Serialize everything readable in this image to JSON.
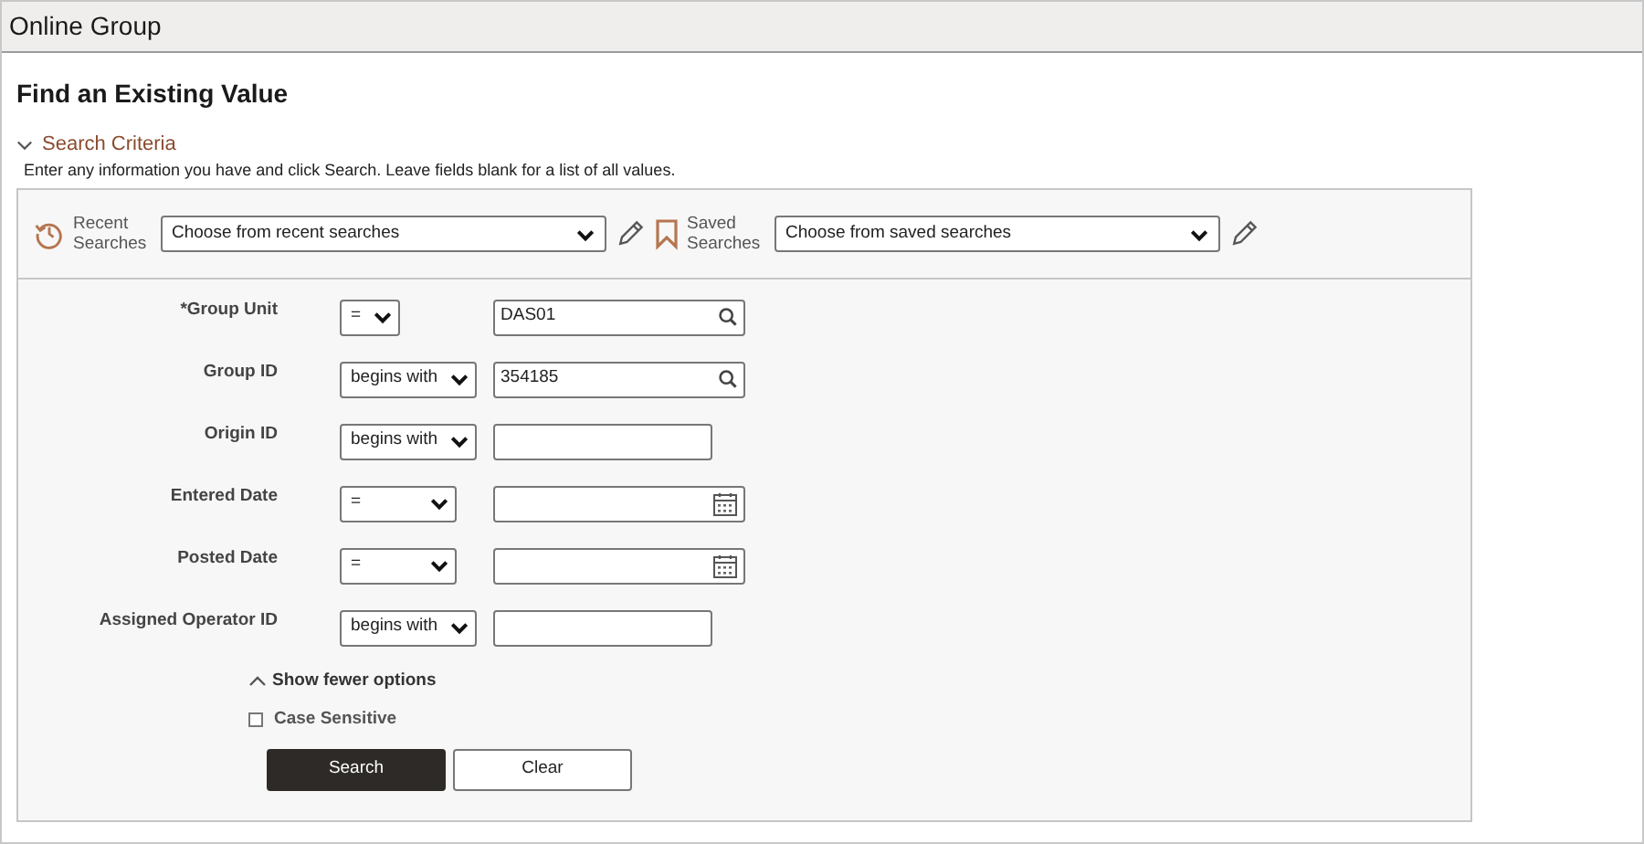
{
  "header": {
    "title": "Online Group"
  },
  "page_title": "Find an Existing Value",
  "section": {
    "title": "Search Criteria",
    "expanded": true
  },
  "instructions": "Enter any information you have and click Search. Leave fields blank for a list of all values.",
  "recent": {
    "label": "Recent Searches",
    "placeholder": "Choose from recent searches"
  },
  "saved": {
    "label": "Saved Searches",
    "placeholder": "Choose from saved searches"
  },
  "criteria": [
    {
      "label": "*Group Unit",
      "operator": "=",
      "kind": "lookup",
      "value": "DAS01"
    },
    {
      "label": "Group ID",
      "operator": "begins with",
      "kind": "lookup",
      "value": "354185"
    },
    {
      "label": "Origin ID",
      "operator": "begins with",
      "kind": "text"
    },
    {
      "label": "Entered Date",
      "operator": "=",
      "kind": "date"
    },
    {
      "label": "Posted Date",
      "operator": "=",
      "kind": "date"
    },
    {
      "label": "Assigned Operator ID",
      "operator": "begins with",
      "kind": "text"
    }
  ],
  "options_toggle": {
    "label": "Show fewer options",
    "expanded": true
  },
  "case_sensitive": {
    "label": "Case Sensitive",
    "checked": false
  },
  "buttons": [
    {
      "label": "Search",
      "kind": "primary"
    },
    {
      "label": "Clear",
      "kind": "secondary"
    }
  ]
}
